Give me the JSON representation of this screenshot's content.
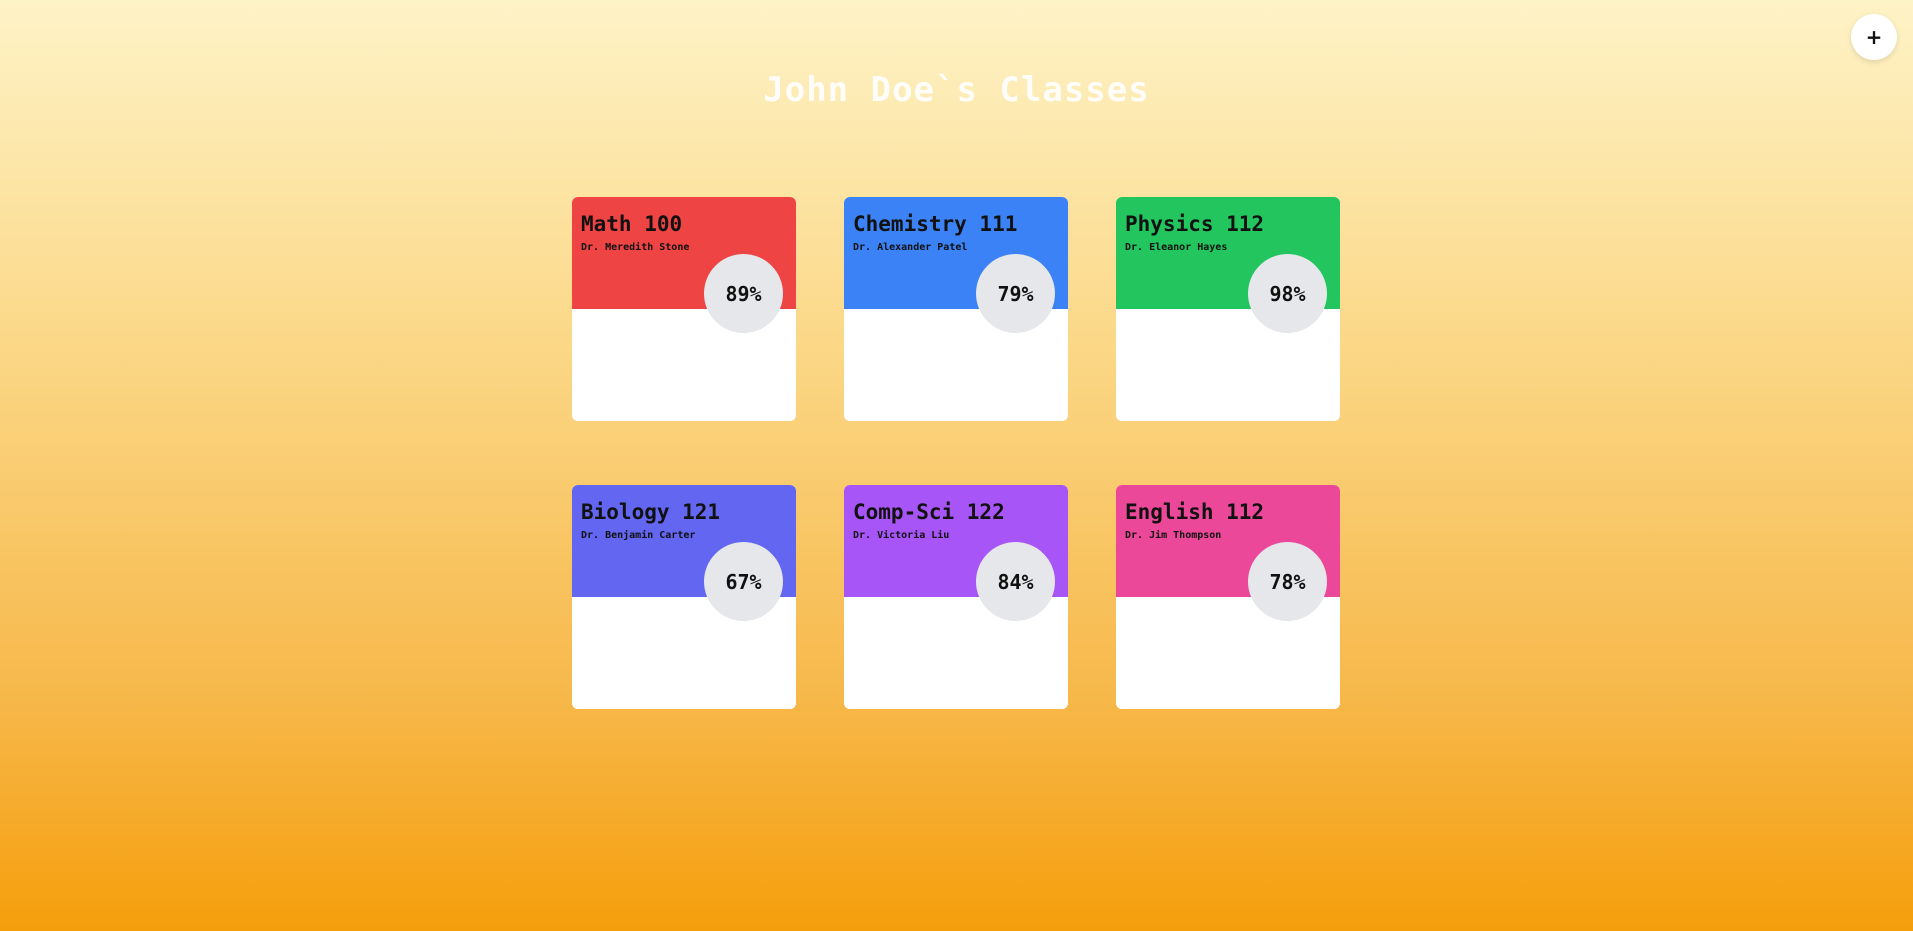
{
  "header": {
    "title": "John Doe`s Classes",
    "add_label": "+"
  },
  "classes": [
    {
      "name": "Math 100",
      "teacher": "Dr. Meredith Stone",
      "grade": "89%",
      "color": "#ef4444"
    },
    {
      "name": "Chemistry 111",
      "teacher": "Dr. Alexander Patel",
      "grade": "79%",
      "color": "#3b82f6"
    },
    {
      "name": "Physics 112",
      "teacher": "Dr. Eleanor Hayes",
      "grade": "98%",
      "color": "#22c55e"
    },
    {
      "name": "Biology 121",
      "teacher": "Dr. Benjamin Carter",
      "grade": "67%",
      "color": "#6366f1"
    },
    {
      "name": "Comp-Sci 122",
      "teacher": "Dr. Victoria Liu",
      "grade": "84%",
      "color": "#a855f7"
    },
    {
      "name": "English 112",
      "teacher": "Dr. Jim Thompson",
      "grade": "78%",
      "color": "#ec4899"
    }
  ]
}
